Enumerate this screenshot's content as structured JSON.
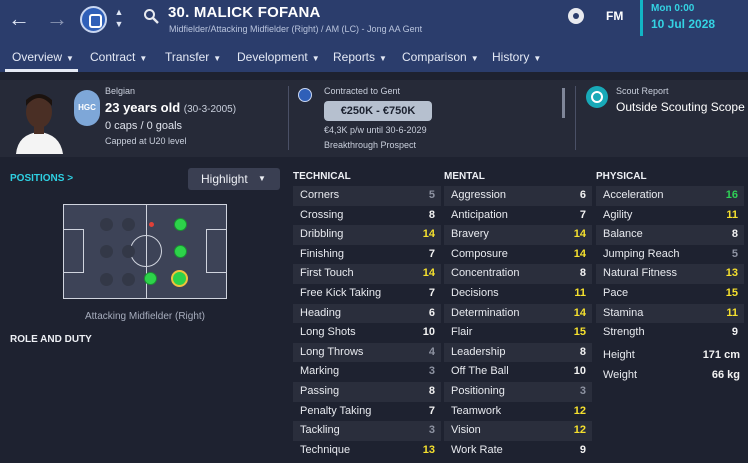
{
  "header": {
    "title": "30. MALICK FOFANA",
    "subtitle": "Midfielder/Attacking Midfielder (Right) / AM (LC) - Jong AA Gent",
    "logo": "FM",
    "date_day": "Mon 0:00",
    "date": "10 Jul 2028"
  },
  "tabs": [
    {
      "label": "Overview"
    },
    {
      "label": "Contract"
    },
    {
      "label": "Transfer"
    },
    {
      "label": "Development"
    },
    {
      "label": "Reports"
    },
    {
      "label": "Comparison"
    },
    {
      "label": "History"
    }
  ],
  "info": {
    "nationality": "Belgian",
    "age": "23 years old",
    "dob": "(30-3-2005)",
    "caps": "0 caps / 0 goals",
    "capped": "Capped at U20 level",
    "badge_text": "HGC",
    "contract_label": "Contracted to Gent",
    "value": "€250K - €750K",
    "wage": "€4,3K p/w until 30-6-2029",
    "prospect": "Breakthrough Prospect",
    "scout_label": "Scout Report",
    "scout_value": "Outside Scouting Scope"
  },
  "positions": {
    "title": "POSITIONS >",
    "highlight": "Highlight",
    "caption": "Attacking Midfielder (Right)",
    "role_title": "ROLE AND DUTY"
  },
  "attributes": {
    "technical_title": "TECHNICAL",
    "mental_title": "MENTAL",
    "physical_title": "PHYSICAL",
    "technical": [
      {
        "name": "Corners",
        "value": "5"
      },
      {
        "name": "Crossing",
        "value": "8"
      },
      {
        "name": "Dribbling",
        "value": "14"
      },
      {
        "name": "Finishing",
        "value": "7"
      },
      {
        "name": "First Touch",
        "value": "14"
      },
      {
        "name": "Free Kick Taking",
        "value": "7"
      },
      {
        "name": "Heading",
        "value": "6"
      },
      {
        "name": "Long Shots",
        "value": "10"
      },
      {
        "name": "Long Throws",
        "value": "4"
      },
      {
        "name": "Marking",
        "value": "3"
      },
      {
        "name": "Passing",
        "value": "8"
      },
      {
        "name": "Penalty Taking",
        "value": "7"
      },
      {
        "name": "Tackling",
        "value": "3"
      },
      {
        "name": "Technique",
        "value": "13"
      }
    ],
    "mental": [
      {
        "name": "Aggression",
        "value": "6"
      },
      {
        "name": "Anticipation",
        "value": "7"
      },
      {
        "name": "Bravery",
        "value": "14"
      },
      {
        "name": "Composure",
        "value": "14"
      },
      {
        "name": "Concentration",
        "value": "8"
      },
      {
        "name": "Decisions",
        "value": "11"
      },
      {
        "name": "Determination",
        "value": "14"
      },
      {
        "name": "Flair",
        "value": "15"
      },
      {
        "name": "Leadership",
        "value": "8"
      },
      {
        "name": "Off The Ball",
        "value": "10"
      },
      {
        "name": "Positioning",
        "value": "3"
      },
      {
        "name": "Teamwork",
        "value": "12"
      },
      {
        "name": "Vision",
        "value": "12"
      },
      {
        "name": "Work Rate",
        "value": "9"
      }
    ],
    "physical": [
      {
        "name": "Acceleration",
        "value": "16"
      },
      {
        "name": "Agility",
        "value": "11"
      },
      {
        "name": "Balance",
        "value": "8"
      },
      {
        "name": "Jumping Reach",
        "value": "5"
      },
      {
        "name": "Natural Fitness",
        "value": "13"
      },
      {
        "name": "Pace",
        "value": "15"
      },
      {
        "name": "Stamina",
        "value": "11"
      },
      {
        "name": "Strength",
        "value": "9"
      }
    ],
    "height_label": "Height",
    "height": "171 cm",
    "weight_label": "Weight",
    "weight": "66 kg"
  },
  "colors": {
    "header_bg": "#2b3d6c",
    "accent": "#2ed0e2",
    "high": "#2fd156",
    "good": "#f5e02e",
    "mid": "#f2f2f2",
    "low": "#8e93a2"
  }
}
